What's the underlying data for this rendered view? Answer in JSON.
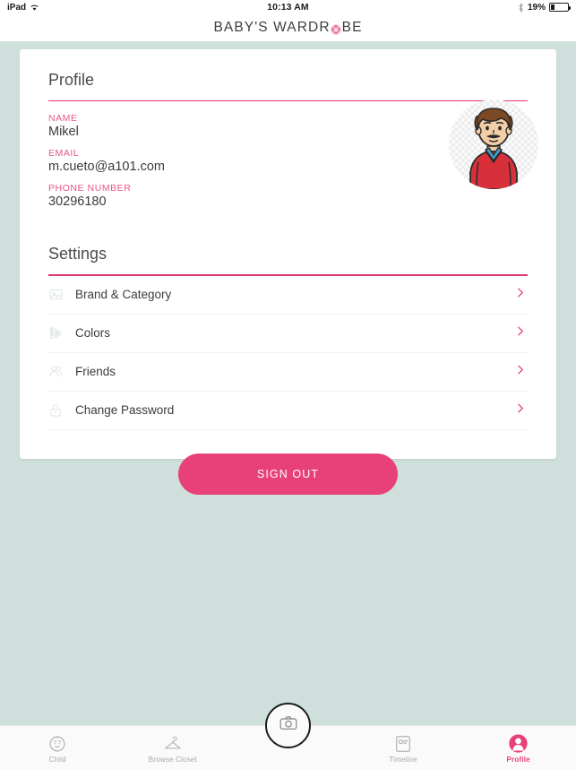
{
  "statusbar": {
    "device": "iPad",
    "wifi_icon": "wifi-icon",
    "time": "10:13 AM",
    "bluetooth_icon": "bluetooth-icon",
    "battery_percent": "19%",
    "battery_icon": "battery-icon"
  },
  "navbar": {
    "title_before": "BABY'S WARDR",
    "title_after": "BE",
    "flower_icon": "flower-logo-icon"
  },
  "profile": {
    "heading": "Profile",
    "edit_icon": "pencil-icon",
    "fields": [
      {
        "label": "NAME",
        "value": "Mikel"
      },
      {
        "label": "EMAIL",
        "value": "m.cueto@a101.com"
      },
      {
        "label": "PHONE NUMBER",
        "value": "30296180"
      }
    ],
    "avatar_alt": "user-avatar"
  },
  "settings": {
    "heading": "Settings",
    "rows": [
      {
        "label": "Brand & Category",
        "icon": "image-tag-icon"
      },
      {
        "label": "Colors",
        "icon": "color-palette-icon"
      },
      {
        "label": "Friends",
        "icon": "people-icon"
      },
      {
        "label": "Change Password",
        "icon": "lock-icon"
      }
    ],
    "chevron_icon": "chevron-right-icon"
  },
  "actions": {
    "sign_out_label": "SIGN OUT"
  },
  "tabbar": {
    "tabs": [
      {
        "label": "Child",
        "icon": "baby-face-icon",
        "active": false
      },
      {
        "label": "Browse Closet",
        "icon": "hanger-icon",
        "active": false
      },
      {
        "label": "Timeline",
        "icon": "timeline-card-icon",
        "active": false
      },
      {
        "label": "Profile",
        "icon": "person-circle-icon",
        "active": true
      }
    ],
    "camera_icon": "camera-icon"
  },
  "colors": {
    "accent_pink": "#e8417a",
    "label_pink": "#e7558a",
    "rule_pink": "#e0366e",
    "page_background": "#cfdfdb",
    "card_background": "#ffffff",
    "text_dark": "#3b3b40",
    "icon_gray": "#dfe6e5"
  }
}
